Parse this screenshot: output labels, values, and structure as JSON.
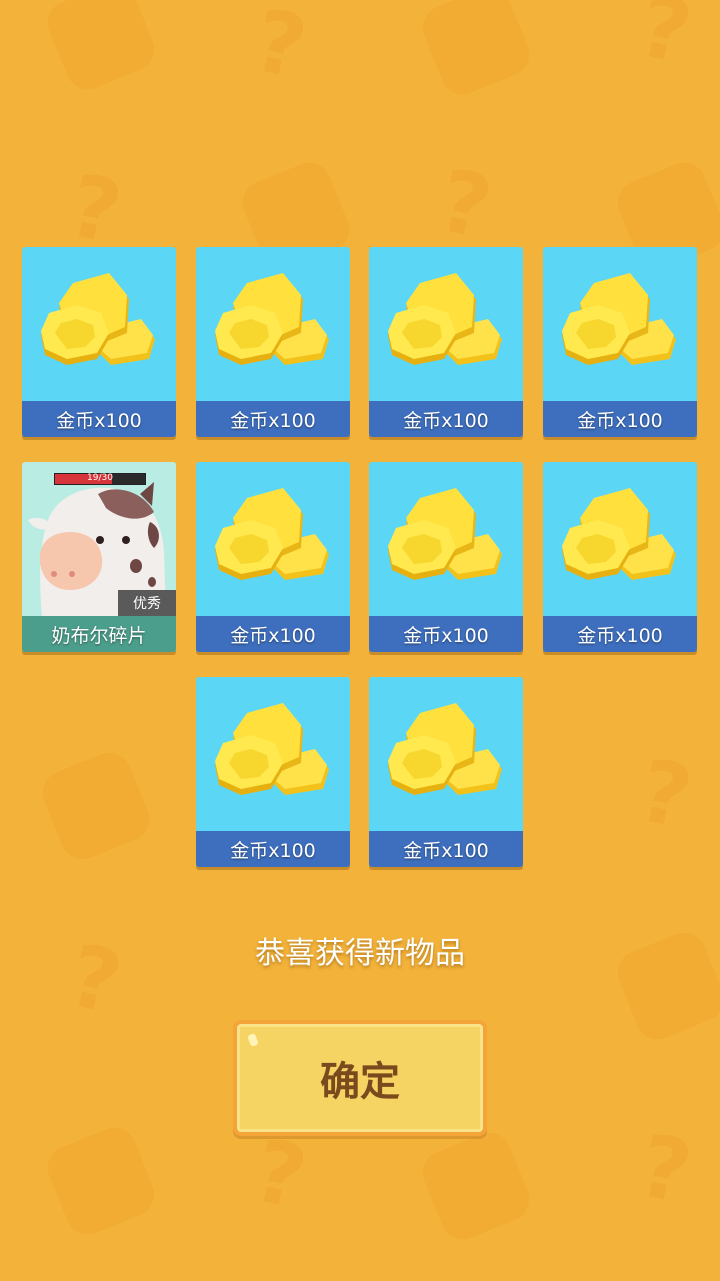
{
  "rewards": [
    {
      "type": "coin",
      "label": "金币x100",
      "icon": "gold-coins-icon"
    },
    {
      "type": "coin",
      "label": "金币x100",
      "icon": "gold-coins-icon"
    },
    {
      "type": "coin",
      "label": "金币x100",
      "icon": "gold-coins-icon"
    },
    {
      "type": "coin",
      "label": "金币x100",
      "icon": "gold-coins-icon"
    },
    {
      "type": "fragment",
      "label": "奶布尔碎片",
      "icon": "cow-icon",
      "progress_text": "19/30",
      "progress": 0.633,
      "rarity": "优秀"
    },
    {
      "type": "coin",
      "label": "金币x100",
      "icon": "gold-coins-icon"
    },
    {
      "type": "coin",
      "label": "金币x100",
      "icon": "gold-coins-icon"
    },
    {
      "type": "coin",
      "label": "金币x100",
      "icon": "gold-coins-icon"
    },
    {
      "type": "coin",
      "label": "金币x100",
      "icon": "gold-coins-icon"
    },
    {
      "type": "coin",
      "label": "金币x100",
      "icon": "gold-coins-icon"
    }
  ],
  "message": "恭喜获得新物品",
  "confirm_label": "确定",
  "colors": {
    "background": "#F3B33A",
    "coin_card": "#5CD6F5",
    "coin_label_bar": "#3E6FBF",
    "fragment_card": "#B9EDE3",
    "fragment_label_bar": "#4C9E8C",
    "button": "#F6D463",
    "button_text": "#7A4A1E"
  }
}
